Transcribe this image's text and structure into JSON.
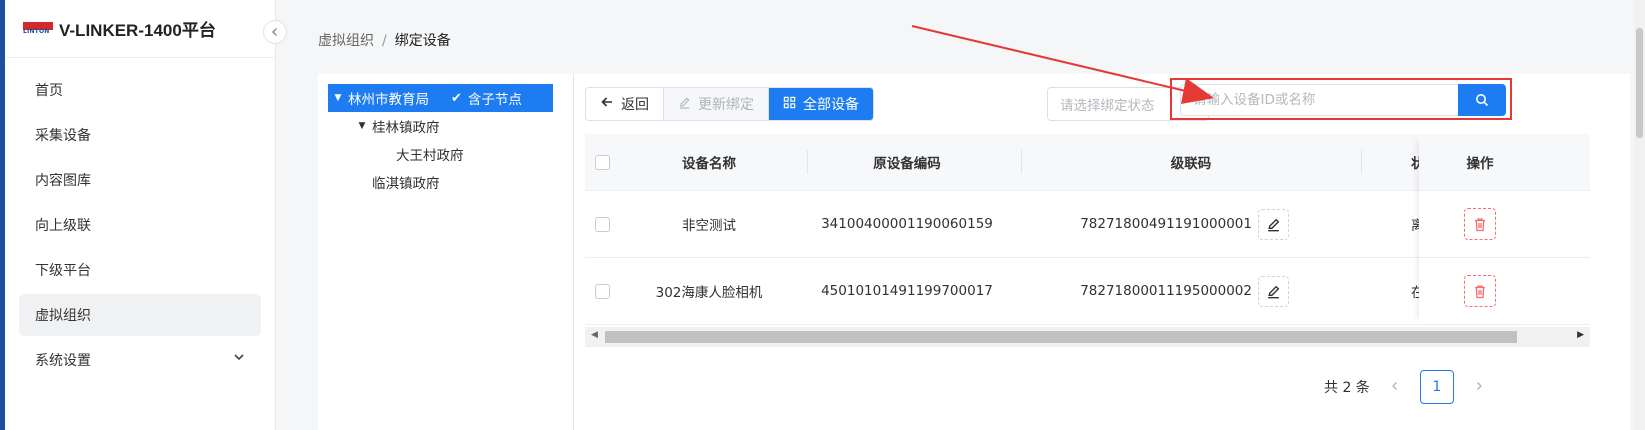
{
  "app": {
    "logo_text": "LINTON",
    "title": "V-LINKER-1400平台"
  },
  "sidebar": {
    "items": [
      {
        "label": "首页",
        "active": false
      },
      {
        "label": "采集设备",
        "active": false
      },
      {
        "label": "内容图库",
        "active": false
      },
      {
        "label": "向上级联",
        "active": false
      },
      {
        "label": "下级平台",
        "active": false
      },
      {
        "label": "虚拟组织",
        "active": true
      },
      {
        "label": "系统设置",
        "active": false,
        "expandable": true
      }
    ]
  },
  "breadcrumb": {
    "parent": "虚拟组织",
    "separator": "/",
    "current": "绑定设备"
  },
  "tree": {
    "root": {
      "label": "林州市教育局",
      "include_children_label": "含子节点"
    },
    "children": [
      {
        "label": "桂林镇政府",
        "children": [
          {
            "label": "大王村政府"
          }
        ]
      },
      {
        "label": "临淇镇政府"
      }
    ]
  },
  "toolbar": {
    "back_label": "返回",
    "update_bind_label": "更新绑定",
    "all_devices_label": "全部设备",
    "status_placeholder": "请选择绑定状态",
    "search_placeholder": "请输入设备ID或名称"
  },
  "table": {
    "headers": {
      "name": "设备名称",
      "original_code": "原设备编码",
      "cascade_code": "级联码",
      "status": "状态",
      "action": "操作"
    },
    "rows": [
      {
        "name": "非空测试",
        "original_code": "34100400001190060159",
        "cascade_code": "78271800491191000001",
        "status": "离线"
      },
      {
        "name": "302海康人脸相机",
        "original_code": "45010101491199700017",
        "cascade_code": "78271800011195000002",
        "status": "在线"
      }
    ]
  },
  "pagination": {
    "total_label": "共 2 条",
    "current_page": "1"
  },
  "colors": {
    "primary": "#1e7cf2",
    "danger": "#f56c6c",
    "annotation": "#e53935",
    "sidebar_accent": "#1d4f9e"
  }
}
